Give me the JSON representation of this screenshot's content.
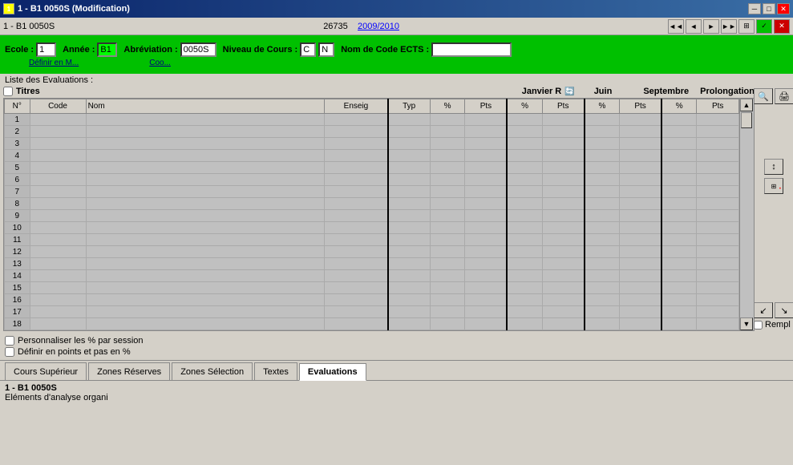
{
  "titleBar": {
    "title": "1 - B1  0050S  (Modification)",
    "icon": "app-icon",
    "minBtn": "─",
    "maxBtn": "□",
    "closeBtn": "✕"
  },
  "menuBar": {
    "left": "1 - B1  0050S",
    "center": "26735",
    "yearLink": "2009/2010",
    "navBtns": [
      "◄◄",
      "◄",
      "►",
      "►►",
      "⊞",
      "✓",
      "✕"
    ]
  },
  "topForm": {
    "ecoleLabel": "Ecole :",
    "ecoleValue": "1",
    "anneeLabel": "Année :",
    "anneeValue": "B1",
    "abreviationLabel": "Abréviation :",
    "abreviationValue": "0050S",
    "niveauLabel": "Niveau de Cours :",
    "niveauCode": "C",
    "niveauValue": "N",
    "nomCodeLabel": "Nom de Code ECTS :",
    "nomCodeValue": "",
    "subLabel1": "Définir en M...",
    "subLabel2": "Coo..."
  },
  "evalSection": {
    "listLabel": "Liste des Evaluations :"
  },
  "tableHeaders": {
    "checkbox": "",
    "titresLabel": "Titres",
    "sessions": [
      {
        "name": "Janvier R",
        "cols": [
          "Typ",
          "%",
          "Pts"
        ]
      },
      {
        "name": "Juin",
        "cols": [
          "%",
          "Pts"
        ]
      },
      {
        "name": "Septembre",
        "cols": [
          "%",
          "Pts"
        ]
      },
      {
        "name": "Prolongation",
        "cols": [
          "%",
          "Pts"
        ]
      }
    ],
    "colN": "N°",
    "colCode": "Code",
    "colNom": "Nom",
    "colEnseig": "Enseig"
  },
  "tableRows": [
    {
      "n": "1"
    },
    {
      "n": "2"
    },
    {
      "n": "3"
    },
    {
      "n": "4"
    },
    {
      "n": "5"
    },
    {
      "n": "6"
    },
    {
      "n": "7"
    },
    {
      "n": "8"
    },
    {
      "n": "9"
    },
    {
      "n": "10"
    },
    {
      "n": "11"
    },
    {
      "n": "12"
    },
    {
      "n": "13"
    },
    {
      "n": "14"
    },
    {
      "n": "15"
    },
    {
      "n": "16"
    },
    {
      "n": "17"
    },
    {
      "n": "18"
    }
  ],
  "rightIcons": {
    "searchIcon": "🔍",
    "printIcon": "🖨",
    "sortIcon": "↕",
    "dotIcon": "•",
    "gridIcon": "⊞",
    "arrowDownIcon": "↙",
    "arrowRightIcon": "↘"
  },
  "checkboxes": {
    "personaliser": {
      "label": "Personnaliser les % par session",
      "checked": false
    },
    "definir": {
      "label": "Définir en points et pas en %",
      "checked": false
    },
    "rempl": {
      "label": "Rempl",
      "checked": false
    }
  },
  "tabs": [
    {
      "id": "cours-superieur",
      "label": "Cours Supérieur",
      "active": false
    },
    {
      "id": "zones-reserves",
      "label": "Zones Réserves",
      "active": false
    },
    {
      "id": "zones-selection",
      "label": "Zones Sélection",
      "active": false
    },
    {
      "id": "textes",
      "label": "Textes",
      "active": false
    },
    {
      "id": "evaluations",
      "label": "Evaluations",
      "active": true
    }
  ],
  "statusBar": {
    "line1": "1 - B1  0050S",
    "line2": "Eléments d'analyse organi"
  }
}
